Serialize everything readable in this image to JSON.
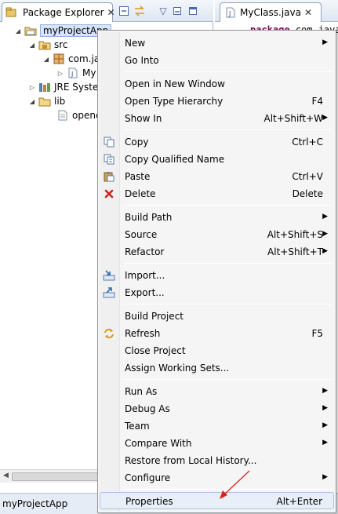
{
  "package_explorer": {
    "tab_label": "Package Explorer",
    "tree": [
      {
        "label": "myProjectApp"
      },
      {
        "label": "src"
      },
      {
        "label": "com.ja"
      },
      {
        "label": "My"
      },
      {
        "label": "JRE Syster"
      },
      {
        "label": "lib"
      },
      {
        "label": "openc"
      }
    ]
  },
  "editor": {
    "tab_label": "MyClass.java",
    "code_keyword": "package",
    "code_rest": "com.java"
  },
  "context_menu": {
    "items": [
      {
        "label": "New",
        "shortcut": "",
        "submenu": true
      },
      {
        "label": "Go Into",
        "shortcut": ""
      },
      {
        "label": "Open in New Window",
        "shortcut": ""
      },
      {
        "label": "Open Type Hierarchy",
        "shortcut": "F4"
      },
      {
        "label": "Show In",
        "shortcut": "Alt+Shift+W",
        "submenu": true
      },
      {
        "label": "Copy",
        "shortcut": "Ctrl+C",
        "icon": "copy-icon"
      },
      {
        "label": "Copy Qualified Name",
        "shortcut": "",
        "icon": "copy-qualified-icon"
      },
      {
        "label": "Paste",
        "shortcut": "Ctrl+V",
        "icon": "paste-icon"
      },
      {
        "label": "Delete",
        "shortcut": "Delete",
        "icon": "delete-icon"
      },
      {
        "label": "Build Path",
        "shortcut": "",
        "submenu": true
      },
      {
        "label": "Source",
        "shortcut": "Alt+Shift+S",
        "submenu": true
      },
      {
        "label": "Refactor",
        "shortcut": "Alt+Shift+T",
        "submenu": true
      },
      {
        "label": "Import...",
        "shortcut": "",
        "icon": "import-icon"
      },
      {
        "label": "Export...",
        "shortcut": "",
        "icon": "export-icon"
      },
      {
        "label": "Build Project",
        "shortcut": ""
      },
      {
        "label": "Refresh",
        "shortcut": "F5",
        "icon": "refresh-icon"
      },
      {
        "label": "Close Project",
        "shortcut": ""
      },
      {
        "label": "Assign Working Sets...",
        "shortcut": ""
      },
      {
        "label": "Run As",
        "shortcut": "",
        "submenu": true
      },
      {
        "label": "Debug As",
        "shortcut": "",
        "submenu": true
      },
      {
        "label": "Team",
        "shortcut": "",
        "submenu": true
      },
      {
        "label": "Compare With",
        "shortcut": "",
        "submenu": true
      },
      {
        "label": "Restore from Local History...",
        "shortcut": ""
      },
      {
        "label": "Configure",
        "shortcut": "",
        "submenu": true
      },
      {
        "label": "Properties",
        "shortcut": "Alt+Enter",
        "highlighted": true
      }
    ]
  },
  "status_bar": {
    "text": "myProjectApp"
  },
  "colors": {
    "highlight_border": "#a8c4e6",
    "annotation_arrow": "#e0201a",
    "keyword": "#7f0055"
  }
}
